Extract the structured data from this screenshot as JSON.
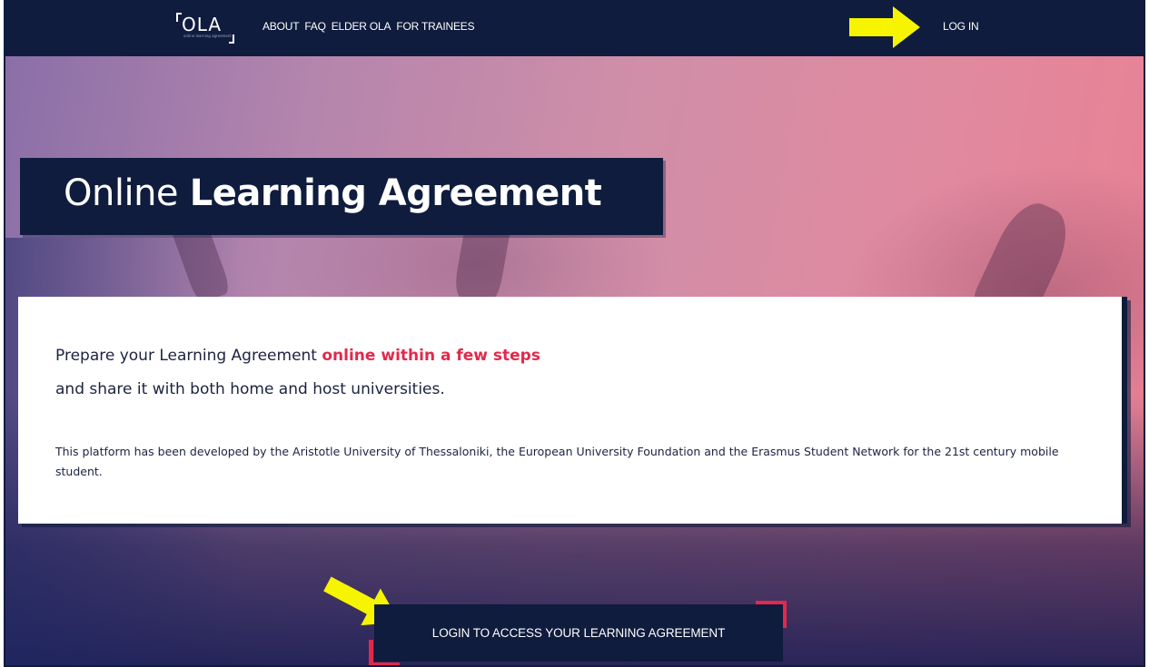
{
  "navbar": {
    "logo_text": "OLA",
    "logo_subtitle": "online learning agreement",
    "links": [
      "ABOUT",
      "FAQ",
      "ELDER OLA",
      "FOR TRAINEES"
    ],
    "login_label": "LOG IN"
  },
  "hero": {
    "title_light": "Online",
    "title_bold": "Learning Agreement"
  },
  "info": {
    "line1_prefix": "Prepare your Learning Agreement ",
    "line1_highlight": "online within a few steps",
    "line2": "and share it with both home and host universities.",
    "description": "This platform has been developed by the Aristotle University of Thessaloniki, the European University Foundation and the Erasmus Student Network for the 21st century mobile student."
  },
  "cta": {
    "label": "LOGIN TO ACCESS YOUR LEARNING AGREEMENT"
  },
  "colors": {
    "navy": "#0f1c3d",
    "accent_red": "#e2294b",
    "annotation_arrow": "#f7f400"
  },
  "annotations": {
    "arrow_icon": "right-arrow-icon"
  }
}
